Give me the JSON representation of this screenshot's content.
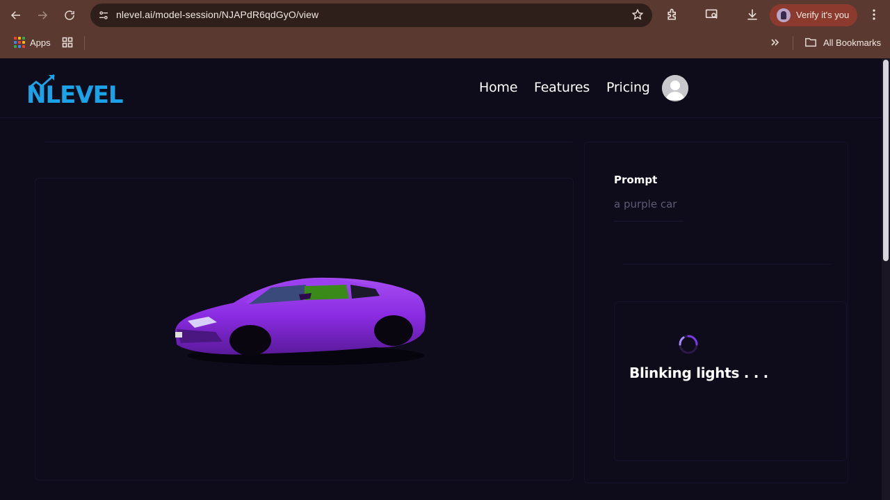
{
  "browser": {
    "url": "nlevel.ai/model-session/NJAPdR6qdGyO/view",
    "profile_label": "Verify it's you",
    "bookmarks": {
      "apps_label": "Apps",
      "all_bookmarks_label": "All Bookmarks"
    }
  },
  "header": {
    "logo_text": "NLEVEL",
    "nav": [
      {
        "label": "Home"
      },
      {
        "label": "Features"
      },
      {
        "label": "Pricing"
      }
    ]
  },
  "session": {
    "prompt_title": "Prompt",
    "prompt_value": "a purple car",
    "status_text": "Blinking lights . . ."
  },
  "colors": {
    "page_bg": "#0e0b1a",
    "chrome_bg": "#5a3a30",
    "accent_blue": "#1aa3e8",
    "car_purple": "#8a2be2",
    "spinner": "#7c3aed"
  },
  "icons": [
    "back-icon",
    "forward-icon",
    "reload-icon",
    "site-settings-icon",
    "star-icon",
    "extensions-icon",
    "screen-search-icon",
    "download-icon",
    "kebab-menu-icon",
    "apps-grid-icon",
    "tab-groups-icon",
    "chevron-double-right-icon",
    "folder-icon",
    "user-avatar-icon",
    "loading-spinner-icon"
  ]
}
